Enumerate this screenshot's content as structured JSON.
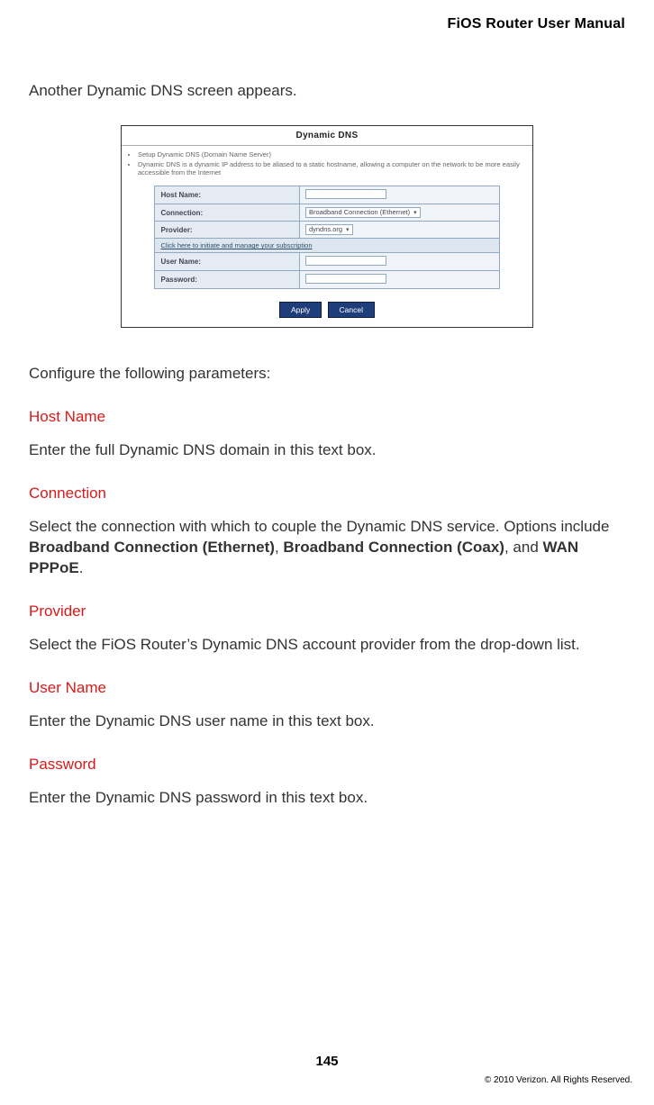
{
  "header": {
    "title": "FiOS Router User Manual"
  },
  "intro": "Another Dynamic DNS screen appears.",
  "screenshot": {
    "title": "Dynamic DNS",
    "bullets": [
      "Setup Dynamic DNS (Domain Name Server)",
      "Dynamic DNS is a dynamic IP address to be aliased to a static hostname, allowing a computer on the network to be more easily accessible from the Internet"
    ],
    "rows": {
      "host_name": {
        "label": "Host Name:"
      },
      "connection": {
        "label": "Connection:",
        "value": "Broadband Connection (Ethernet)"
      },
      "provider": {
        "label": "Provider:",
        "value": "dyndns.org"
      },
      "link": {
        "text": "Click here to initiate and manage your subscription"
      },
      "user_name": {
        "label": "User Name:"
      },
      "password": {
        "label": "Password:"
      }
    },
    "buttons": {
      "apply": "Apply",
      "cancel": "Cancel"
    }
  },
  "configure_text": "Configure the following parameters:",
  "sections": {
    "host_name": {
      "heading": "Host Name",
      "body": "Enter the full Dynamic DNS domain in this text box."
    },
    "connection": {
      "heading": "Connection",
      "body_pre": "Select the connection with which to couple the Dynamic DNS service. Options include ",
      "opt1": "Broadband Connection (Ethernet)",
      "sep1": ", ",
      "opt2": "Broadband Connection (Coax)",
      "sep2": ", and ",
      "opt3": "WAN PPPoE",
      "body_post": "."
    },
    "provider": {
      "heading": "Provider",
      "body": "Select the FiOS Router’s Dynamic DNS account provider from the drop-down list."
    },
    "user_name": {
      "heading": "User Name",
      "body": "Enter the Dynamic DNS user name in this text box."
    },
    "password": {
      "heading": "Password",
      "body": "Enter the Dynamic DNS password in this text box."
    }
  },
  "page_number": "145",
  "copyright": "© 2010 Verizon. All Rights Reserved."
}
